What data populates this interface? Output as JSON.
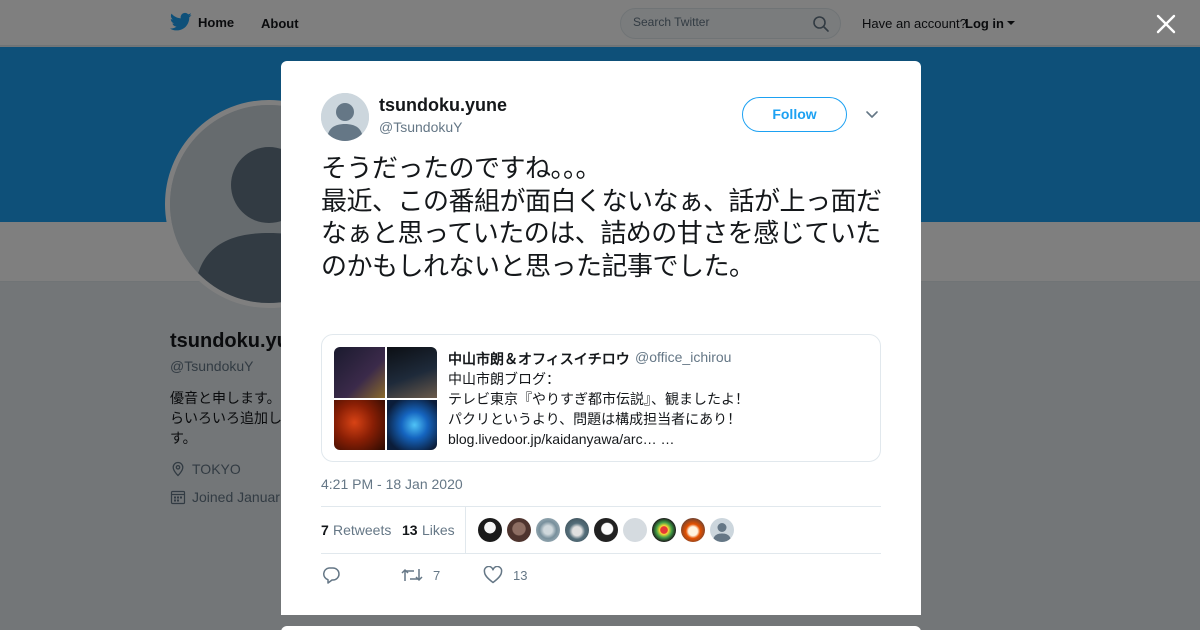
{
  "topbar": {
    "home_label": "Home",
    "about_label": "About",
    "search_placeholder": "Search Twitter",
    "have_account": "Have an account?",
    "login_label": "Log in",
    "brand_color": "#1da1f2"
  },
  "profile": {
    "name": "tsundoku.yu",
    "handle": "@TsundokuY",
    "bio": "優音と申します。\nらいろいろ追加し\nす。",
    "location": "TOKYO",
    "joined": "Joined Januar"
  },
  "tweet": {
    "author_name": "tsundoku.yune",
    "author_handle": "@TsundokuY",
    "follow_label": "Follow",
    "text": "そうだったのですね。。。\n最近、この番組が面白くないなぁ、話が上っ面だなぁと思っていたのは、詰めの甘さを感じていたのかもしれないと思った記事でした。",
    "quote": {
      "author": "中山市朗＆オフィスイチロウ",
      "handle": "@office_ichirou",
      "text": "中山市朗ブログ：\nテレビ東京『やりすぎ都市伝説』、観ましたよ！\nパクリというより、問題は構成担当者にあり！\nblog.livedoor.jp/kaidanyawa/arc… …"
    },
    "timestamp": "4:21 PM - 18 Jan 2020",
    "retweets_count": "7",
    "retweets_label": "Retweets",
    "likes_count": "13",
    "likes_label": "Likes",
    "action_retweets": "7",
    "action_likes": "13"
  }
}
